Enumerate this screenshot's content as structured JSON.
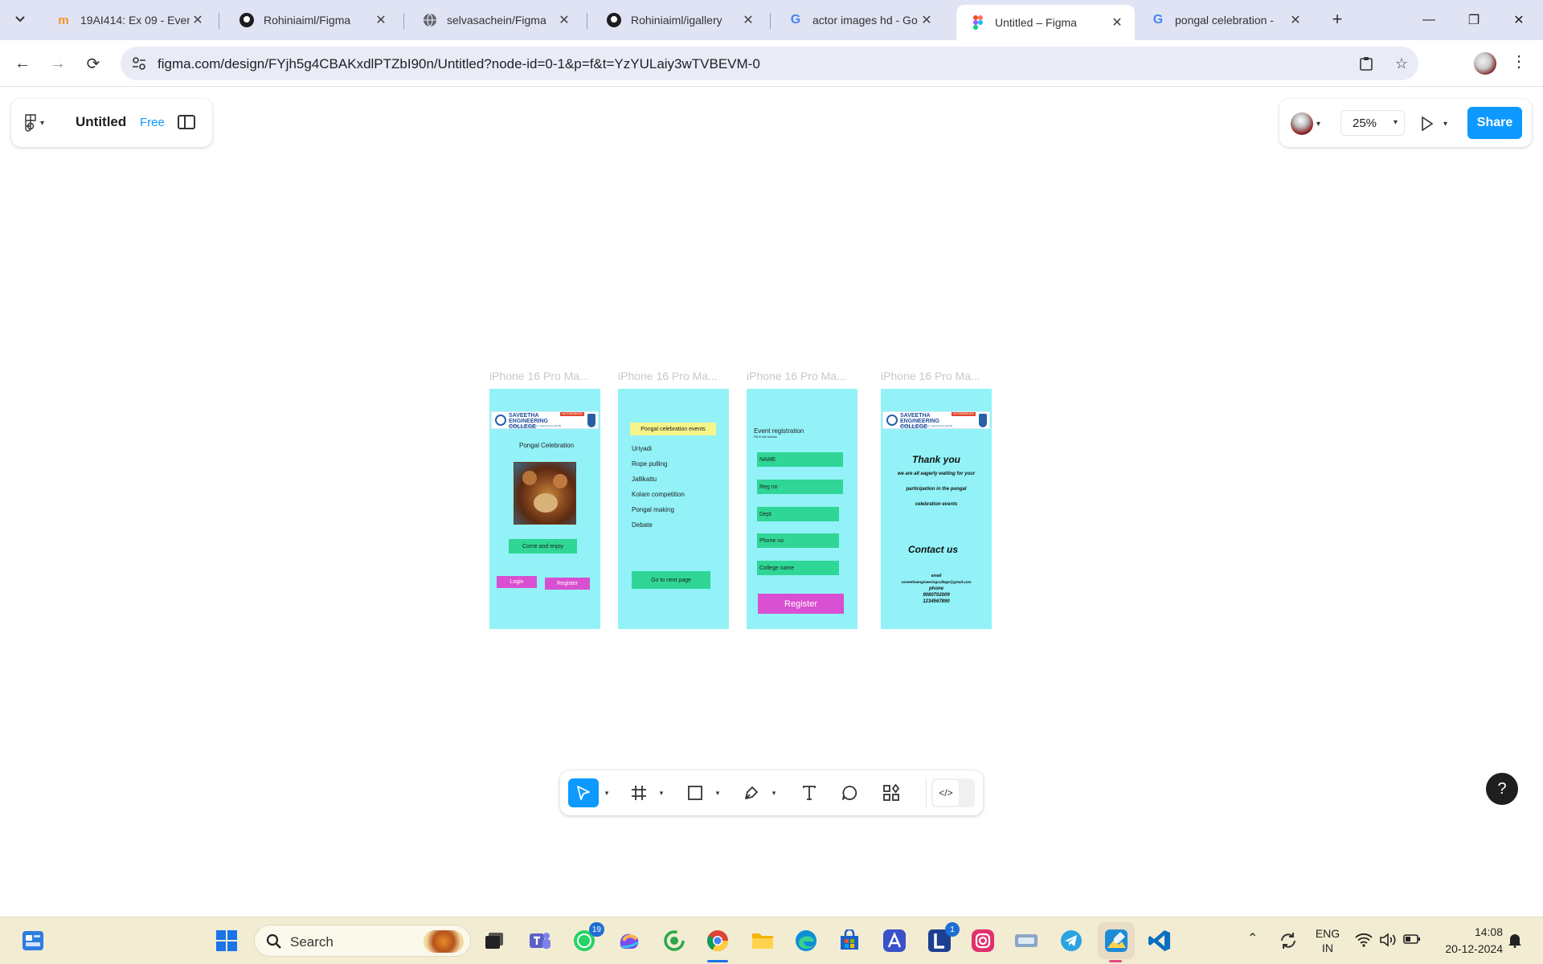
{
  "browser": {
    "tabs": [
      {
        "title": "19AI414: Ex 09 - Even",
        "favicon": "moodle-icon"
      },
      {
        "title": "Rohiniaiml/Figma",
        "favicon": "github-icon"
      },
      {
        "title": "selvasachein/Figma",
        "favicon": "globe-icon"
      },
      {
        "title": "Rohiniaiml/igallery",
        "favicon": "github-icon"
      },
      {
        "title": "actor images hd - Go",
        "favicon": "google-icon"
      },
      {
        "title": "Untitled – Figma",
        "favicon": "figma-icon",
        "active": true
      },
      {
        "title": "pongal celebration -",
        "favicon": "google-icon"
      }
    ],
    "url": "figma.com/design/FYjh5g4CBAKxdlPTZbI90n/Untitled?node-id=0-1&p=f&t=YzYULaiy3wTVBEVM-0"
  },
  "figma": {
    "file_title": "Untitled",
    "plan_badge": "Free",
    "zoom": "25%",
    "share_label": "Share",
    "help_label": "?",
    "frames": [
      {
        "label": "iPhone 16 Pro Ma..."
      },
      {
        "label": "iPhone 16 Pro Ma..."
      },
      {
        "label": "iPhone 16 Pro Ma..."
      },
      {
        "label": "iPhone 16 Pro Ma..."
      }
    ],
    "screen1": {
      "college_name": "SAVEETHA ENGINEERING COLLEGE",
      "college_tag": "AUTONOMOUS",
      "college_sub": "Affiliated to Anna University | Approved by AICTE",
      "heading": "Pongal Celebration",
      "cta": "Come and enjoy",
      "login": "Login",
      "register": "Register"
    },
    "screen2": {
      "heading": "Pongal celebration events",
      "events": [
        "Uriyadi",
        "Rope pulling",
        "Jallikattu",
        "Kolam competition",
        "Pongal making",
        "Debate"
      ],
      "next": "Go to next page"
    },
    "screen3": {
      "heading": "Event registration",
      "subheading": "Fill in the blanks",
      "fields": [
        "NAME",
        "Reg no",
        "Dept",
        "Phone no",
        "College name"
      ],
      "register": "Register"
    },
    "screen4": {
      "college_name": "SAVEETHA ENGINEERING COLLEGE",
      "college_tag": "AUTONOMOUS",
      "college_sub": "Affiliated to Anna University | Approved by AICTE",
      "thank_you": "Thank you",
      "message_1": "we are all eagerly waiting for your",
      "message_2": "participation in the pongal",
      "message_3": "celebration events",
      "contact_heading": "Contact us",
      "email_label": "email",
      "email": "saveethaengineeringcollege@gmail.com",
      "phone_label": "phone",
      "phone_1": "9080702009",
      "phone_2": "1234567890"
    }
  },
  "taskbar": {
    "search_placeholder": "Search",
    "whatsapp_badge": "19",
    "l_badge": "1",
    "lang_1": "ENG",
    "lang_2": "IN",
    "time": "14:08",
    "date": "20-12-2024"
  },
  "colors": {
    "frame_bg": "#92f2f7",
    "green_button": "#2fd696",
    "pink_button": "#d94fd1",
    "figma_blue": "#0d99ff"
  }
}
